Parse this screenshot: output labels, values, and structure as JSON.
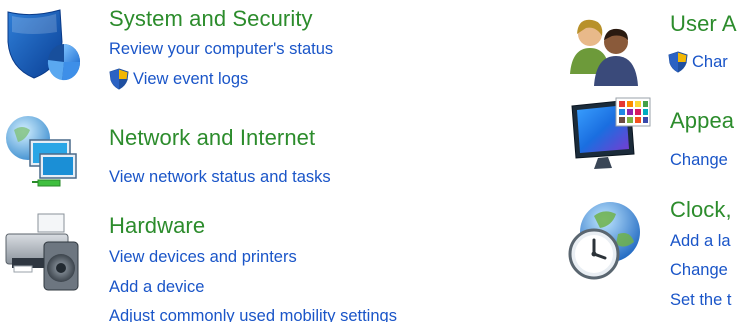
{
  "categories": {
    "system": {
      "title": "System and Security",
      "icon": "shield-pie-icon",
      "links": [
        "Review your computer's status",
        "View event logs"
      ]
    },
    "network": {
      "title": "Network and Internet",
      "icon": "network-monitors-icon",
      "links": [
        "View network status and tasks"
      ]
    },
    "hardware": {
      "title": "Hardware",
      "icon": "printer-speaker-icon",
      "links": [
        "View devices and printers",
        "Add a device",
        "Adjust commonly used mobility settings"
      ]
    },
    "users": {
      "title": "User A",
      "icon": "users-icon",
      "links": [
        "Char"
      ]
    },
    "appearance": {
      "title": "Appea",
      "icon": "monitor-palette-icon",
      "links": [
        "Change"
      ]
    },
    "clock": {
      "title": "Clock,",
      "icon": "globe-clock-icon",
      "links": [
        "Add a la",
        "Change",
        "Set the t"
      ]
    }
  },
  "colors": {
    "title_green": "#2c8c2c",
    "link_blue": "#1a55c8"
  }
}
